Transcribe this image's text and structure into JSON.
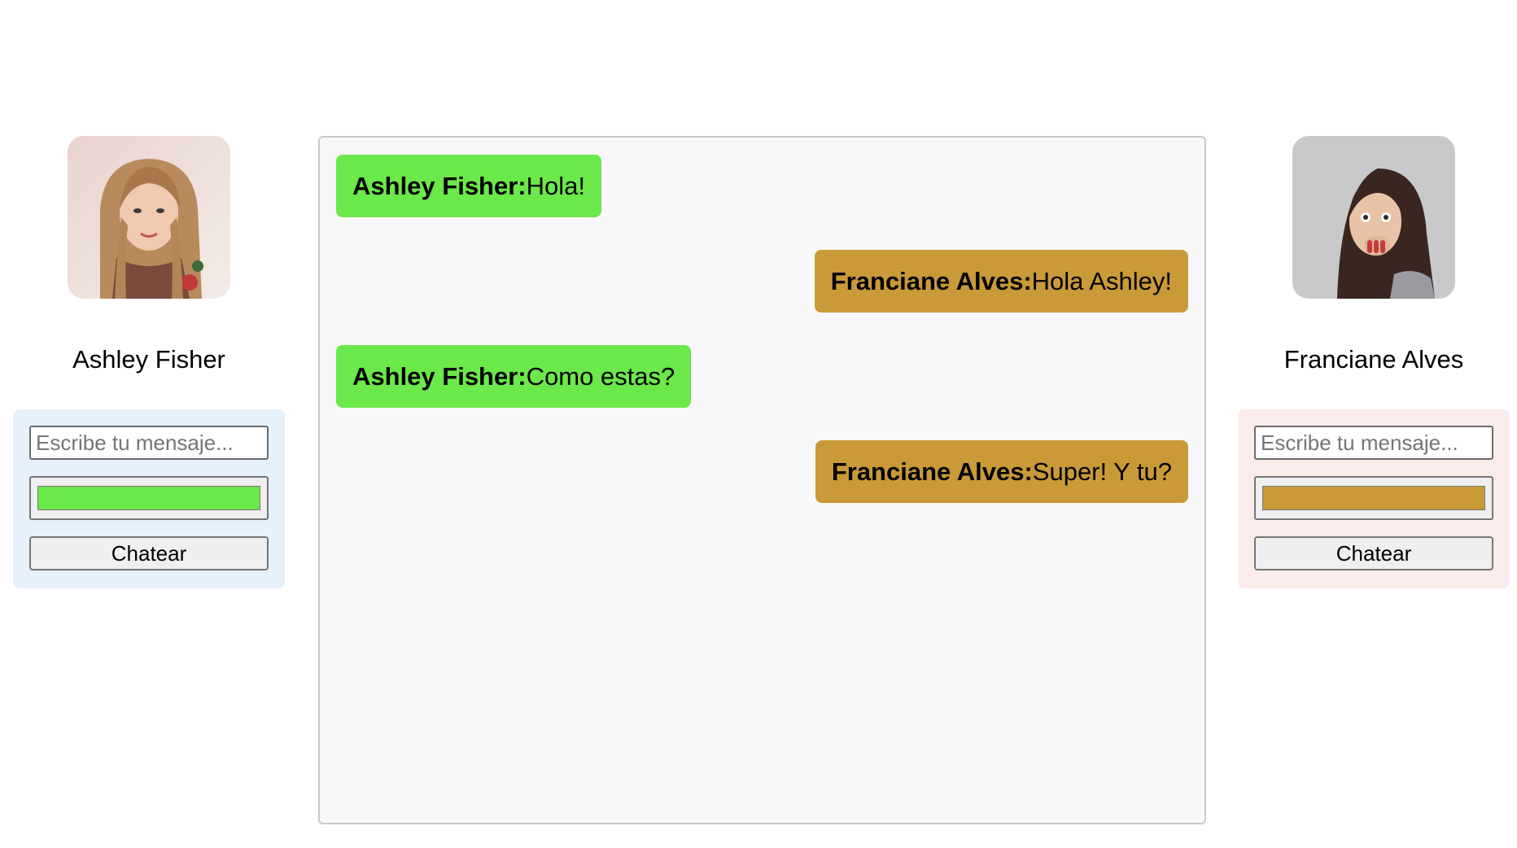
{
  "users": [
    {
      "name": "Ashley Fisher",
      "input_placeholder": "Escribe tu mensaje...",
      "input_value": "",
      "color": "#6be84a",
      "panel_bg": "#e6f1fb",
      "button_label": "Chatear",
      "avatar_icon": "user-photo"
    },
    {
      "name": "Franciane Alves",
      "input_placeholder": "Escribe tu mensaje...",
      "input_value": "",
      "color": "#c99a37",
      "panel_bg": "#fcebeb",
      "button_label": "Chatear",
      "avatar_icon": "user-photo"
    }
  ],
  "messages": [
    {
      "sender": "Ashley Fisher:",
      "text": "Hola!",
      "side": "left",
      "color": "#6be84a"
    },
    {
      "sender": "Franciane Alves:",
      "text": "Hola Ashley!",
      "side": "right",
      "color": "#c99a37"
    },
    {
      "sender": "Ashley Fisher:",
      "text": "Como estas?",
      "side": "left",
      "color": "#6be84a"
    },
    {
      "sender": "Franciane Alves:",
      "text": "Super! Y tu?",
      "side": "right",
      "color": "#c99a37"
    }
  ]
}
